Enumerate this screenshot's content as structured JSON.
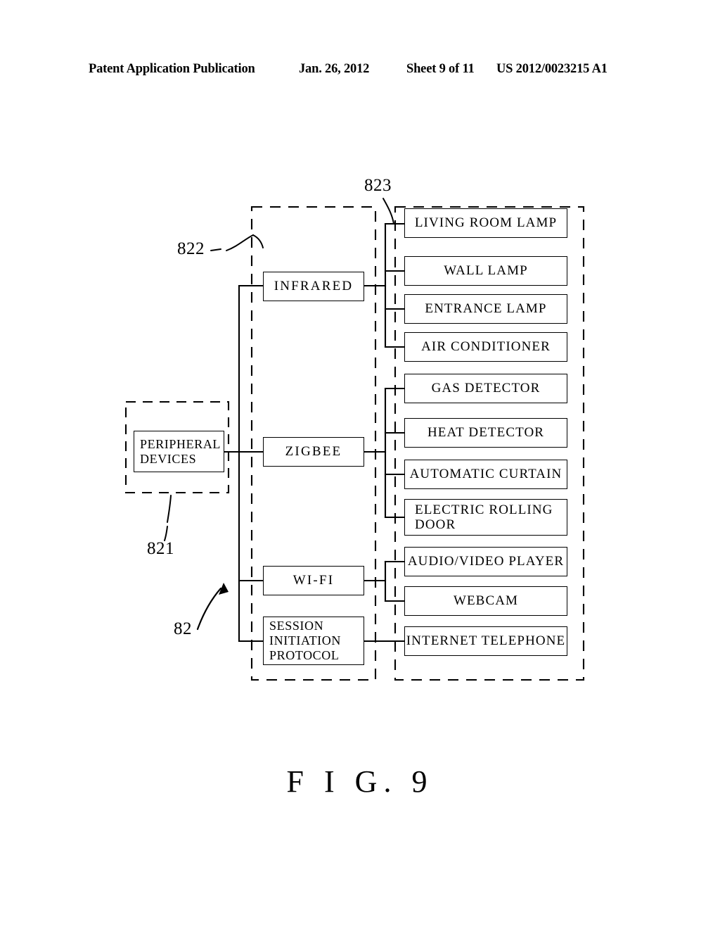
{
  "header": {
    "publication": "Patent Application Publication",
    "date": "Jan. 26, 2012",
    "sheet": "Sheet 9 of 11",
    "pub_number": "US 2012/0023215 A1"
  },
  "figure": {
    "caption": "F I G. 9",
    "colors": {
      "line": "#000000",
      "background": "#ffffff"
    },
    "reference_numerals": [
      {
        "id": "ref-82",
        "label": "82"
      },
      {
        "id": "ref-821",
        "label": "821"
      },
      {
        "id": "ref-822",
        "label": "822"
      },
      {
        "id": "ref-823",
        "label": "823"
      }
    ],
    "peripheral": {
      "label": "PERIPHERAL\nDEVICES",
      "line1": "PERIPHERAL",
      "line2": "DEVICES"
    },
    "protocols": [
      {
        "id": "infrared",
        "label": "INFRARED"
      },
      {
        "id": "zigbee",
        "label": "ZIGBEE"
      },
      {
        "id": "wifi",
        "label": "WI-FI"
      },
      {
        "id": "sip",
        "label": "SESSION\nINITIATION\nPROTOCOL",
        "line1": "SESSION",
        "line2": "INITIATION",
        "line3": "PROTOCOL"
      }
    ],
    "devices": [
      {
        "id": "living-room-lamp",
        "label": "LIVING ROOM LAMP",
        "protocol": "infrared"
      },
      {
        "id": "wall-lamp",
        "label": "WALL LAMP",
        "protocol": "infrared"
      },
      {
        "id": "entrance-lamp",
        "label": "ENTRANCE LAMP",
        "protocol": "infrared"
      },
      {
        "id": "air-conditioner",
        "label": "AIR CONDITIONER",
        "protocol": "infrared"
      },
      {
        "id": "gas-detector",
        "label": "GAS DETECTOR",
        "protocol": "zigbee"
      },
      {
        "id": "heat-detector",
        "label": "HEAT DETECTOR",
        "protocol": "zigbee"
      },
      {
        "id": "automatic-curtain",
        "label": "AUTOMATIC CURTAIN",
        "protocol": "zigbee"
      },
      {
        "id": "electric-rolling-door",
        "label": "ELECTRIC ROLLING\nDOOR",
        "protocol": "zigbee",
        "line1": "ELECTRIC ROLLING",
        "line2": "DOOR"
      },
      {
        "id": "audio-video-player",
        "label": "AUDIO/VIDEO PLAYER",
        "protocol": "wifi"
      },
      {
        "id": "webcam",
        "label": "WEBCAM",
        "protocol": "wifi"
      },
      {
        "id": "internet-telephone",
        "label": "INTERNET TELEPHONE",
        "protocol": "sip"
      }
    ]
  }
}
